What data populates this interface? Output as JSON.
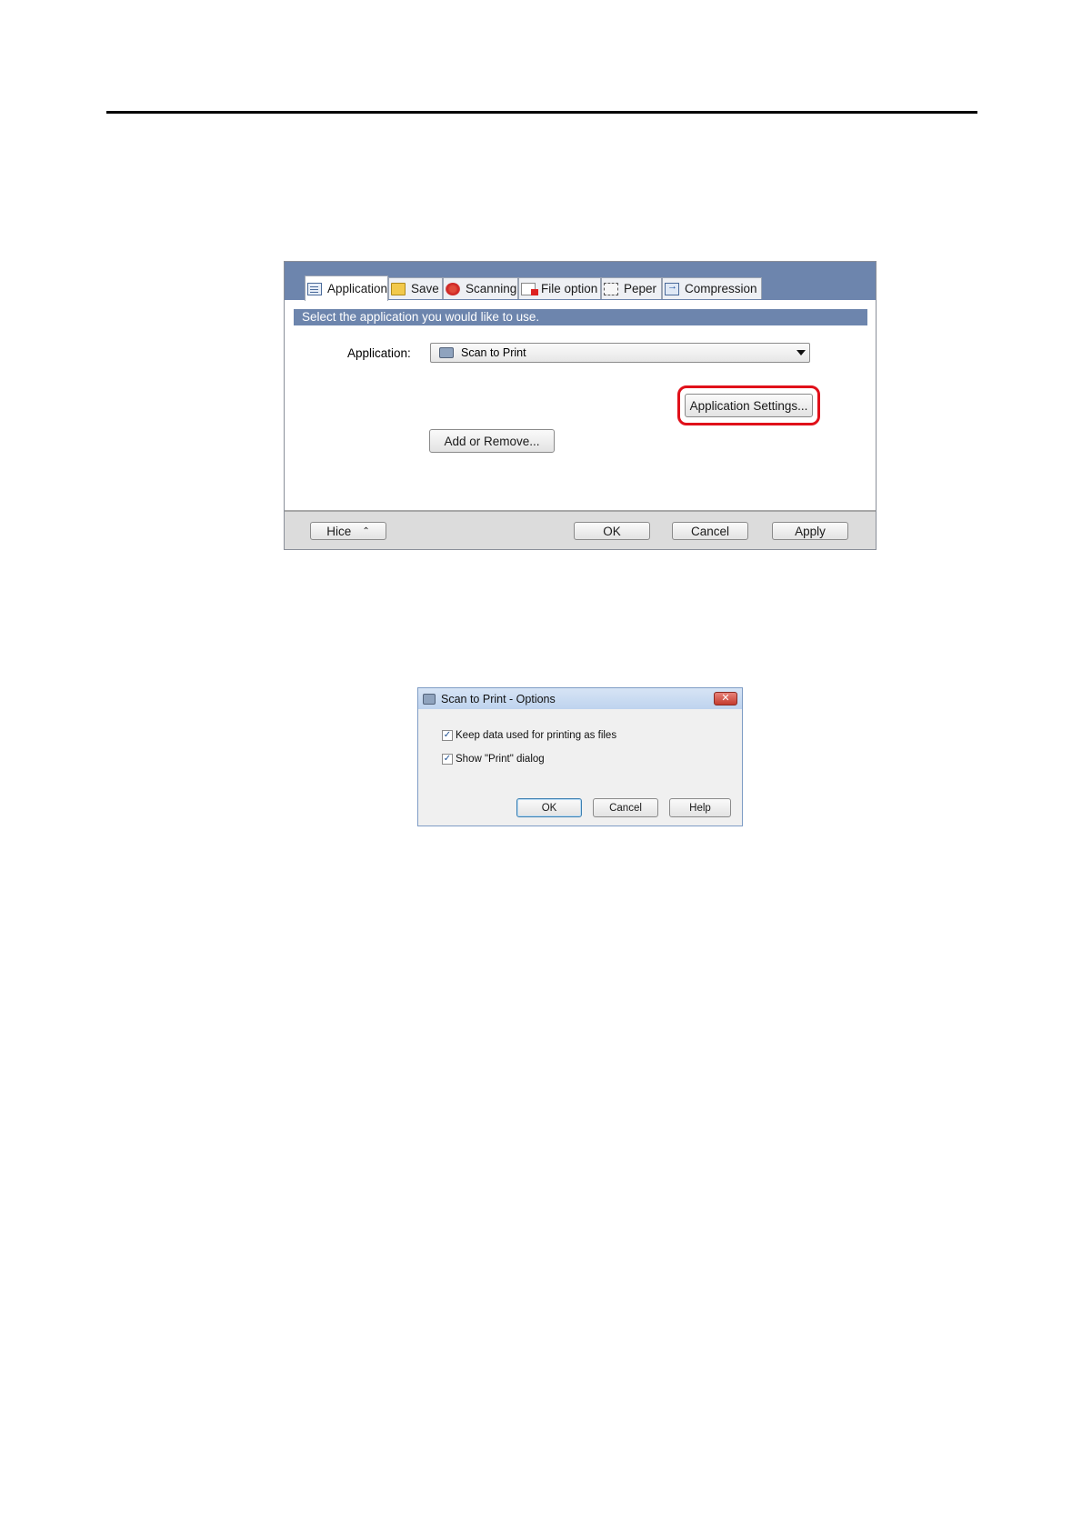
{
  "settings_window": {
    "tabs": [
      {
        "label": "Application",
        "icon": "application-icon"
      },
      {
        "label": "Save",
        "icon": "save-folder-icon"
      },
      {
        "label": "Scanning",
        "icon": "scanning-icon"
      },
      {
        "label": "File option",
        "icon": "pdf-file-icon"
      },
      {
        "label": "Peper",
        "icon": "paper-icon"
      },
      {
        "label": "Compression",
        "icon": "compression-icon"
      }
    ],
    "info_text": "Select the application you would like to use.",
    "application_label": "Application:",
    "application_selected": "Scan to Print",
    "application_settings_button": "Application Settings...",
    "add_remove_button": "Add or Remove...",
    "hide_button": "Hice",
    "ok_button": "OK",
    "cancel_button": "Cancel",
    "apply_button": "Apply",
    "highlight_color": "#e0101a"
  },
  "options_dialog": {
    "title": "Scan to Print - Options",
    "keep_data_label": "Keep data used for printing as files",
    "keep_data_checked": true,
    "show_print_label": "Show \"Print\" dialog",
    "show_print_checked": true,
    "ok_button": "OK",
    "cancel_button": "Cancel",
    "help_button": "Help"
  }
}
